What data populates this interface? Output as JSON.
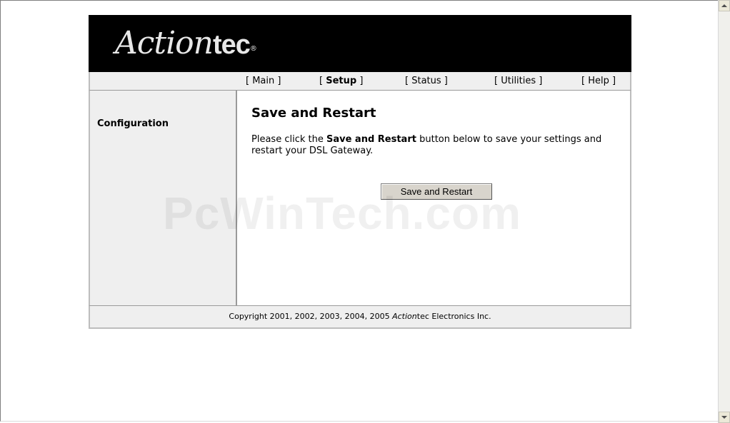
{
  "brand": {
    "logo_script": "Action",
    "logo_tec": "tec",
    "logo_reg": "®"
  },
  "nav": {
    "items": [
      {
        "label": "Main",
        "active": false
      },
      {
        "label": "Setup",
        "active": true
      },
      {
        "label": "Status",
        "active": false
      },
      {
        "label": "Utilities",
        "active": false
      },
      {
        "label": "Help",
        "active": false
      }
    ],
    "open_bracket": "[",
    "close_bracket": "]"
  },
  "sidebar": {
    "section_label": "Configuration"
  },
  "main": {
    "title": "Save and Restart",
    "desc_prefix": "Please click the ",
    "desc_bold": "Save and Restart",
    "desc_suffix": " button below to save your settings and restart your DSL Gateway.",
    "button_label": "Save and Restart"
  },
  "footer": {
    "copyright_prefix": "Copyright 2001, 2002, 2003, 2004, 2005 ",
    "brand_italic": "Action",
    "brand_rest": "tec Electronics Inc."
  },
  "watermark": "PcWinTech.com",
  "colors": {
    "header_bg": "#000000",
    "panel_bg": "#efefef",
    "button_bg": "#d8d4cc"
  }
}
